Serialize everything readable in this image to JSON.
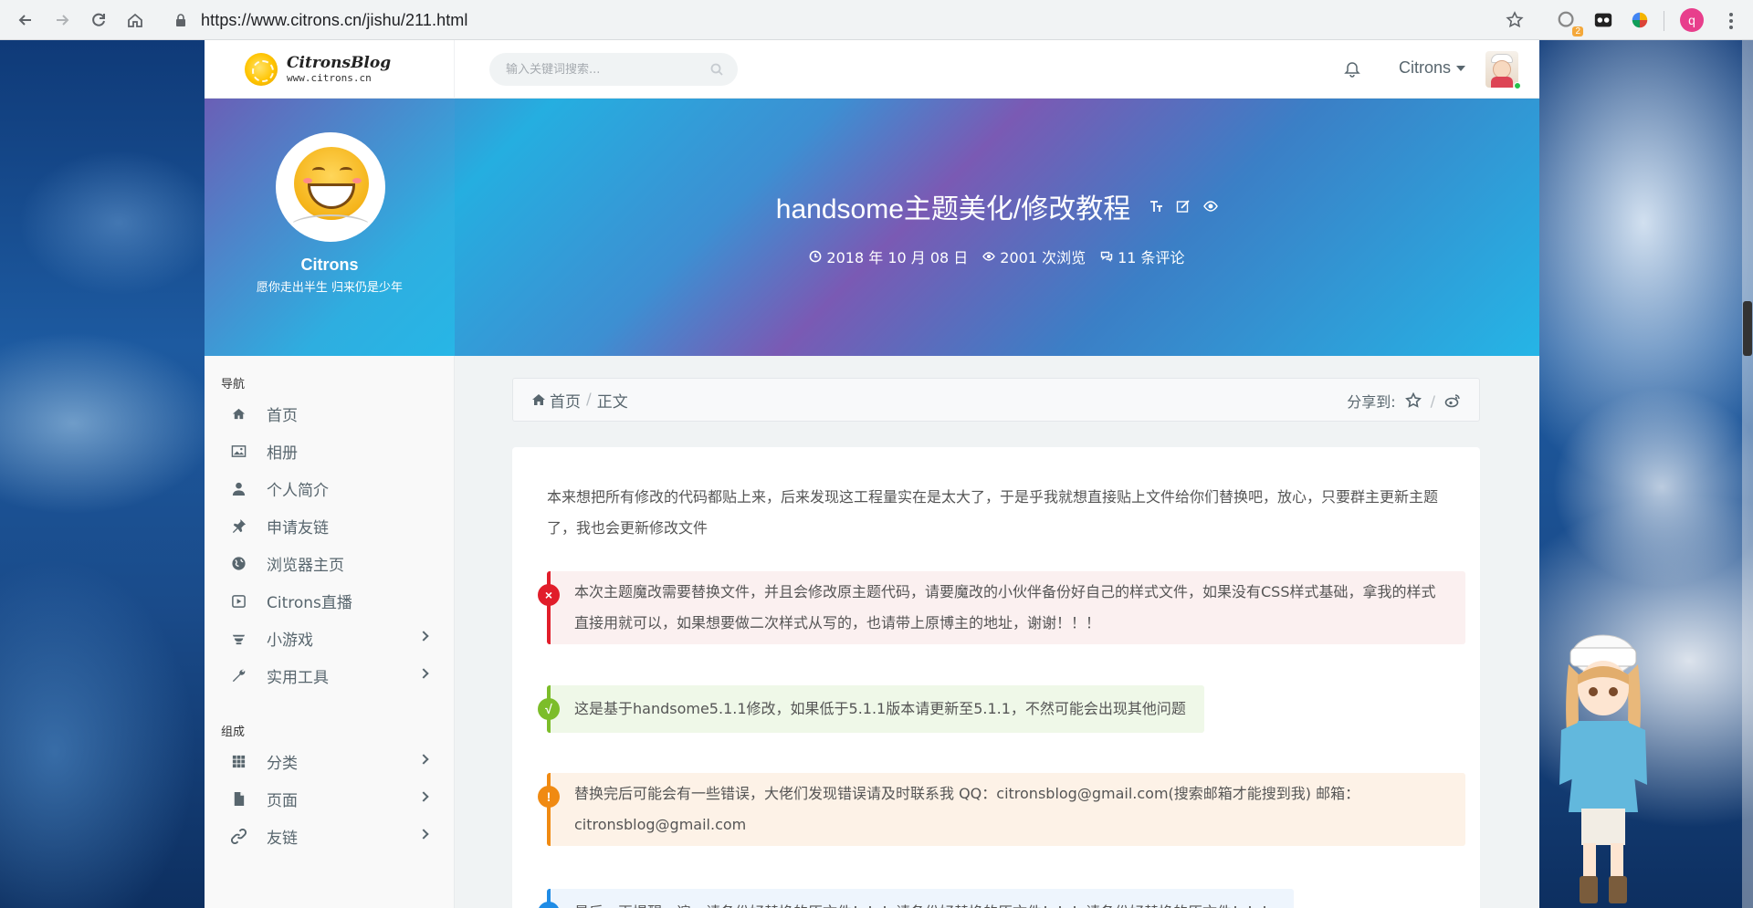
{
  "browser": {
    "url_prefix": "https://",
    "url_host": "www.citrons.cn",
    "url_path": "/jishu/211.html",
    "extension_badge": "2",
    "profile_initial": "q"
  },
  "site": {
    "brand_name": "CitronsBlog",
    "brand_domain": "www.citrons.cn",
    "search_placeholder": "输入关键词搜索...",
    "user_name": "Citrons"
  },
  "profile": {
    "name": "Citrons",
    "motto": "愿你走出半生 归来仍是少年"
  },
  "post": {
    "title": "handsome主题美化/修改教程",
    "date": "2018 年 10 月 08 日",
    "views": "2001 次浏览",
    "comments": "11 条评论"
  },
  "sidebar": {
    "nav_heading": "导航",
    "nav_items": [
      {
        "label": "首页",
        "icon": "home-icon"
      },
      {
        "label": "相册",
        "icon": "image-icon"
      },
      {
        "label": "个人简介",
        "icon": "user-icon"
      },
      {
        "label": "申请友链",
        "icon": "pin-icon"
      },
      {
        "label": "浏览器主页",
        "icon": "globe-icon"
      },
      {
        "label": "Citrons直播",
        "icon": "play-icon"
      },
      {
        "label": "小游戏",
        "icon": "game-icon"
      },
      {
        "label": "实用工具",
        "icon": "wrench-icon"
      }
    ],
    "comp_heading": "组成",
    "comp_items": [
      {
        "label": "分类",
        "icon": "grid-icon"
      },
      {
        "label": "页面",
        "icon": "file-icon"
      },
      {
        "label": "友链",
        "icon": "link-icon"
      }
    ]
  },
  "breadcrumb": {
    "home": "首页",
    "current": "正文",
    "share_label": "分享到:"
  },
  "article": {
    "intro": "本来想把所有修改的代码都贴上来，后来发现这工程量实在是太大了，于是乎我就想直接贴上文件给你们替换吧，放心，只要群主更新主题了，我也会更新修改文件",
    "tip_error": "本次主题魔改需要替换文件，并且会修改原主题代码，请要魔改的小伙伴备份好自己的样式文件，如果没有CSS样式基础，拿我的样式直接用就可以，如果想要做二次样式从写的，也请带上原博主的地址，谢谢！！！",
    "tip_success": "这是基于handsome5.1.1修改，如果低于5.1.1版本请更新至5.1.1，不然可能会出现其他问题",
    "tip_warning": "替换完后可能会有一些错误，大佬们发现错误请及时联系我 QQ：citronsblog@gmail.com(搜索邮箱才能搜到我) 邮箱：citronsblog@gmail.com",
    "tip_info": "最后，再提醒一遍：请备份好替换的原文件！！！请备份好替换的原文件！！！请备份好替换的原文件！！！",
    "badge_error": "×",
    "badge_success": "√",
    "badge_warning": "!",
    "badge_info": "i"
  },
  "colors": {
    "error": "#e11d2a",
    "success": "#7cbd2a",
    "warning": "#f08a12",
    "info": "#1f8ce6",
    "online": "#27c24c"
  }
}
